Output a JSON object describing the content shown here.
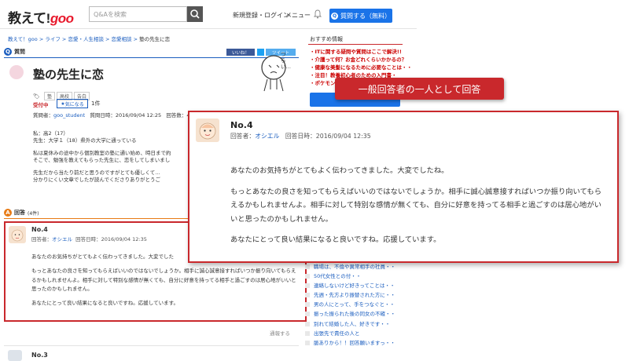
{
  "header": {
    "logo_text": "教えて!",
    "logo_goo": "goo",
    "search_placeholder": "Q&Aを検索",
    "nav_register": "新規登録・ログイン",
    "nav_menu": "メニュー",
    "ask_button": "質問する（無料）"
  },
  "breadcrumb": [
    "教えて！goo",
    "ライフ",
    "恋愛・人生相談",
    "恋愛相談",
    "塾の先生に恋"
  ],
  "question": {
    "section_label": "質問",
    "share_like": "いいね！",
    "share_tweet": "ツイート",
    "title": "塾の先生に恋",
    "tags": [
      "塾",
      "高校",
      "告白"
    ],
    "status": "受付中",
    "watch_label": "気になる",
    "watch_count": "1件",
    "author_label": "質問者：",
    "author": "goo_student",
    "date": "質問日時：2016/09/04 12:25",
    "answer_count": "回答数：4件",
    "body_lines": [
      "私：高2（17）",
      "先生：大学１（18）県外の大学に通っている",
      "私は夏休みの途中から個別教室の塾に通い始め、時日まで約",
      "そこで、勉強を教えてもらった先生に、恋をしてしまいまし",
      "先生だから当たり前だと思うのですがとても優しくて…",
      "分かりにくい文章でしたが読んでくださりありがとうご"
    ],
    "mascot_text": "つらい…"
  },
  "answers_section": {
    "label": "回答",
    "count": "(4件)",
    "report": "通報する"
  },
  "answer4": {
    "number": "No.4",
    "answerer_label": "回答者：",
    "answerer": "オシエル",
    "date": "回答日時：2016/09/04 12:35",
    "paragraphs": [
      "あなたのお気持ちがとてもよく伝わってきました。大変でしたね。",
      "もっとあなたの良さを知ってもらえばいいのではないでしょうか。相手に誠心誠意接すればいつか振り向いてもらえるかもしれませんよ。相手に対して特別な感情が無くても、自分に好意を持ってる相手と過ごすのは居心地がいいと思ったのかもしれません。",
      "あなたにとって良い結果になると良いですね。応援しています。"
    ],
    "paragraphs_small": [
      "あなたのお気持ちがとてもよく伝わってきました。大変でした",
      "もっとあなたの良さを知ってもらえばいいのではないでしょうか。相手に誠心誠意接すればいつか振り向いてもらえるかもしれませんよ。相手に対して特別な感情が無くても、自分に好意を持ってる相手と過ごすのは居心地がいいと思ったのかもしれません。",
      "あなたにとって良い結果になると良いですね。応援しています。"
    ]
  },
  "answer3": {
    "number": "No.3"
  },
  "callout_label": "一般回答者の一人として回答",
  "sidebar": {
    "title": "おすすめ情報",
    "featured": [
      "・ITに関する疑問や質問はここで解決!!",
      "・介護って何？お金どれくらいかかるの？",
      "・健康な美髪になるために必要なことは・・",
      "・注目！教養初心者のための入門書・",
      "・ポケモンGo…"
    ],
    "list": [
      "職場は、不倫や異常相手の社員・・",
      "50代女性との付・・",
      "連絡しないけど好きってことは・・",
      "先週・先方より振替された方に・・",
      "男の人にとって、手をつなぐと・・",
      "振った振られた後の同女の不確・・",
      "別れて結婚した人、好きです・・",
      "出張先で責任の人と",
      "脈ありから！！回答願いますっ・・"
    ]
  },
  "colors": {
    "accent_red": "#c9282c",
    "link_blue": "#1a5dbf",
    "brand_red": "#e8192c",
    "button_blue": "#1a73e8"
  }
}
